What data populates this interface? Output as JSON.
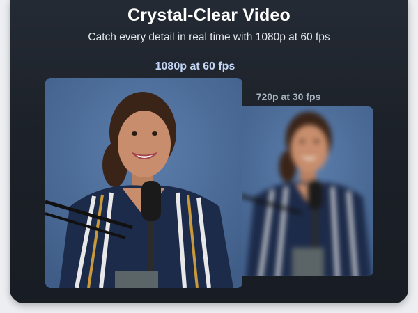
{
  "header": {
    "title": "Crystal-Clear Video",
    "subtitle": "Catch every detail in real time with 1080p at 60 fps"
  },
  "comparison": {
    "high_quality_label": "1080p at 60 fps",
    "low_quality_label": "720p at 30 fps"
  },
  "colors": {
    "card_background": "#1e232b",
    "high_quality_label": "#c3d6f6",
    "low_quality_label": "#aab3c0",
    "video_backdrop": "#4d6d9a"
  }
}
